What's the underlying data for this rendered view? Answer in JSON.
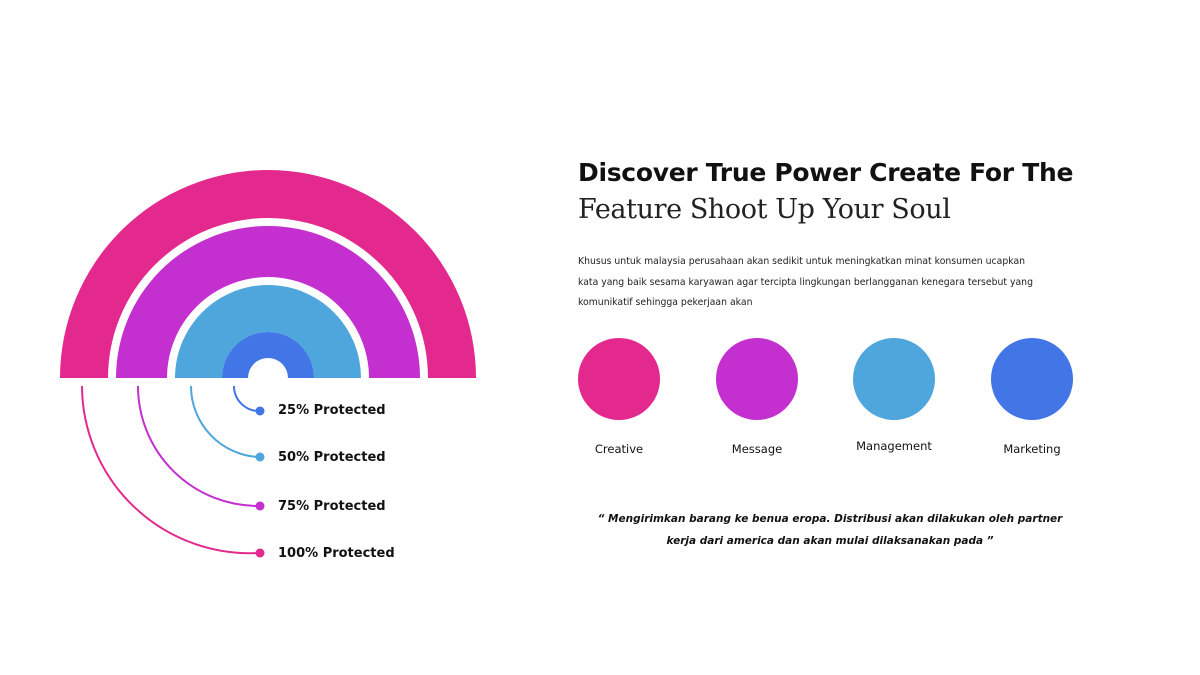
{
  "colors": {
    "pink": "#e3298e",
    "purple": "#c42fcf",
    "light_blue": "#4ea6dc",
    "blue": "#4275e6"
  },
  "diagram": {
    "levels": [
      {
        "label": "25% Protected",
        "color": "#4275e6"
      },
      {
        "label": "50% Protected",
        "color": "#4ea6dc"
      },
      {
        "label": "75% Protected",
        "color": "#c42fcf"
      },
      {
        "label": "100% Protected",
        "color": "#e3298e"
      }
    ]
  },
  "content": {
    "title_line1": "Discover True Power Create For The",
    "title_line2": "Feature Shoot Up Your Soul",
    "body": "Khusus untuk malaysia perusahaan akan sedikit untuk meningkatkan minat konsumen ucapkan kata yang baik sesama karyawan agar tercipta lingkungan berlangganan kenegara tersebut yang komunikatif sehingga pekerjaan akan",
    "categories": [
      {
        "label": "Creative",
        "color": "#e3298e"
      },
      {
        "label": "Message",
        "color": "#c42fcf"
      },
      {
        "label": "Management",
        "color": "#4ea6dc"
      },
      {
        "label": "Marketing",
        "color": "#4275e6"
      }
    ],
    "quote": "“ Mengirimkan barang ke benua eropa. Distribusi akan dilakukan oleh partner kerja dari america dan akan mulai dilaksanakan pada ”"
  }
}
